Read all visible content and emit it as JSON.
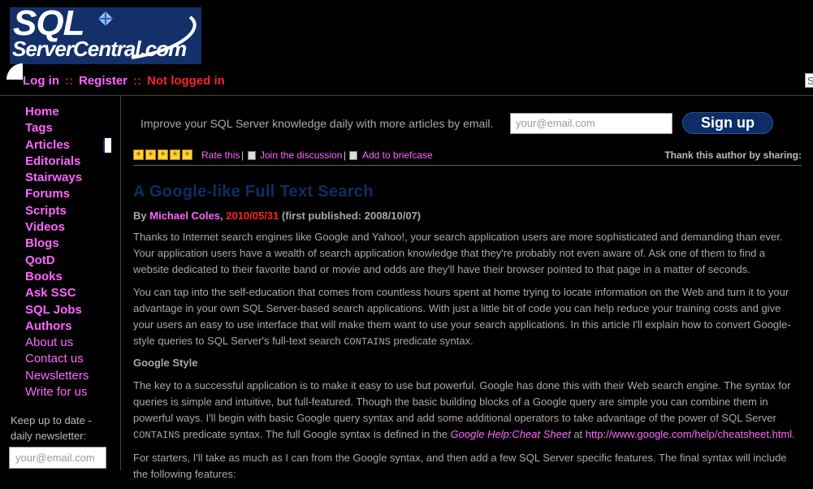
{
  "logo": {
    "line1": "SQL",
    "line2": "ServerCentral.com"
  },
  "topnav": {
    "login": "Log in",
    "sep": "::",
    "register": "Register",
    "status": "Not logged in"
  },
  "search_stub": "S",
  "sidebar": {
    "items": [
      {
        "label": "Home"
      },
      {
        "label": "Tags"
      },
      {
        "label": "Articles"
      },
      {
        "label": "Editorials"
      },
      {
        "label": "Stairways"
      },
      {
        "label": "Forums"
      },
      {
        "label": "Scripts"
      },
      {
        "label": "Videos"
      },
      {
        "label": "Blogs"
      },
      {
        "label": "QotD"
      },
      {
        "label": "Books"
      },
      {
        "label": "Ask SSC"
      },
      {
        "label": "SQL Jobs"
      },
      {
        "label": "Authors"
      },
      {
        "label": "About us"
      },
      {
        "label": "Contact us"
      },
      {
        "label": "Newsletters"
      },
      {
        "label": "Write for us"
      }
    ],
    "keepup_line1": "Keep up to date -",
    "keepup_line2": "daily newsletter:",
    "email_placeholder": "your@email.com"
  },
  "promo": {
    "text": "Improve your SQL Server knowledge daily with more articles by email.",
    "email_placeholder": "your@email.com",
    "signup_label": "Sign up"
  },
  "toolbar": {
    "rate": "Rate this",
    "discuss": "Join the discussion",
    "briefcase": "Add to briefcase",
    "thank": "Thank this author by sharing:",
    "sep": "|",
    "rating_stars": 5
  },
  "article": {
    "title": "A Google-like Full Text Search",
    "by": "By",
    "author": "Michael Coles",
    "comma": ",",
    "date": "2010/05/31",
    "first_published": "(first published: 2008/10/07)",
    "p1": "Thanks to Internet search engines like Google and Yahoo!, your search application users are more sophisticated and demanding than ever. Your application users have a wealth of search application knowledge that they're probably not even aware of. Ask one of them to find a website dedicated to their favorite band or movie and odds are they'll have their browser pointed to that page in a matter of seconds.",
    "p2_a": "You can tap into the self-education that comes from countless hours spent at home trying to locate information on the Web and turn it to your advantage in your own SQL Server-based search applications. With just a little bit of code you can help reduce your training costs and give your users an easy to use interface that will make them want to use your search applications. In this article I'll explain how to convert Google-style queries to SQL Server's full-text search",
    "p2_code": "CONTAINS",
    "p2_b": "predicate syntax.",
    "h_google": "Google Style",
    "p3_a": "The key to a successful application is to make it easy to use but powerful. Google has done this with their Web search engine. The syntax for queries is simple and intuitive, but full-featured. Though the basic building blocks of a Google query are simple you can combine them in powerful ways. I'll begin with basic Google query syntax and add some additional operators to take advantage of the power of SQL Server",
    "p3_code": "CONTAINS",
    "p3_b": "predicate syntax. The full Google syntax is defined in the",
    "p3_cheat": "Google Help:Cheat Sheet",
    "p3_at": "at",
    "p3_url": "http://www.google.com/help/cheatsheet.html",
    "p3_end": ".",
    "p4": "For starters, I'll take as much as I can from the Google syntax, and then add a few SQL Server specific features. The final syntax will include the following features:"
  },
  "colors": {
    "background": "#000000",
    "link": "#ff66ff",
    "alert": "#ff2222",
    "brand_blue": "#13306b",
    "body_text": "#a9a9a9"
  }
}
